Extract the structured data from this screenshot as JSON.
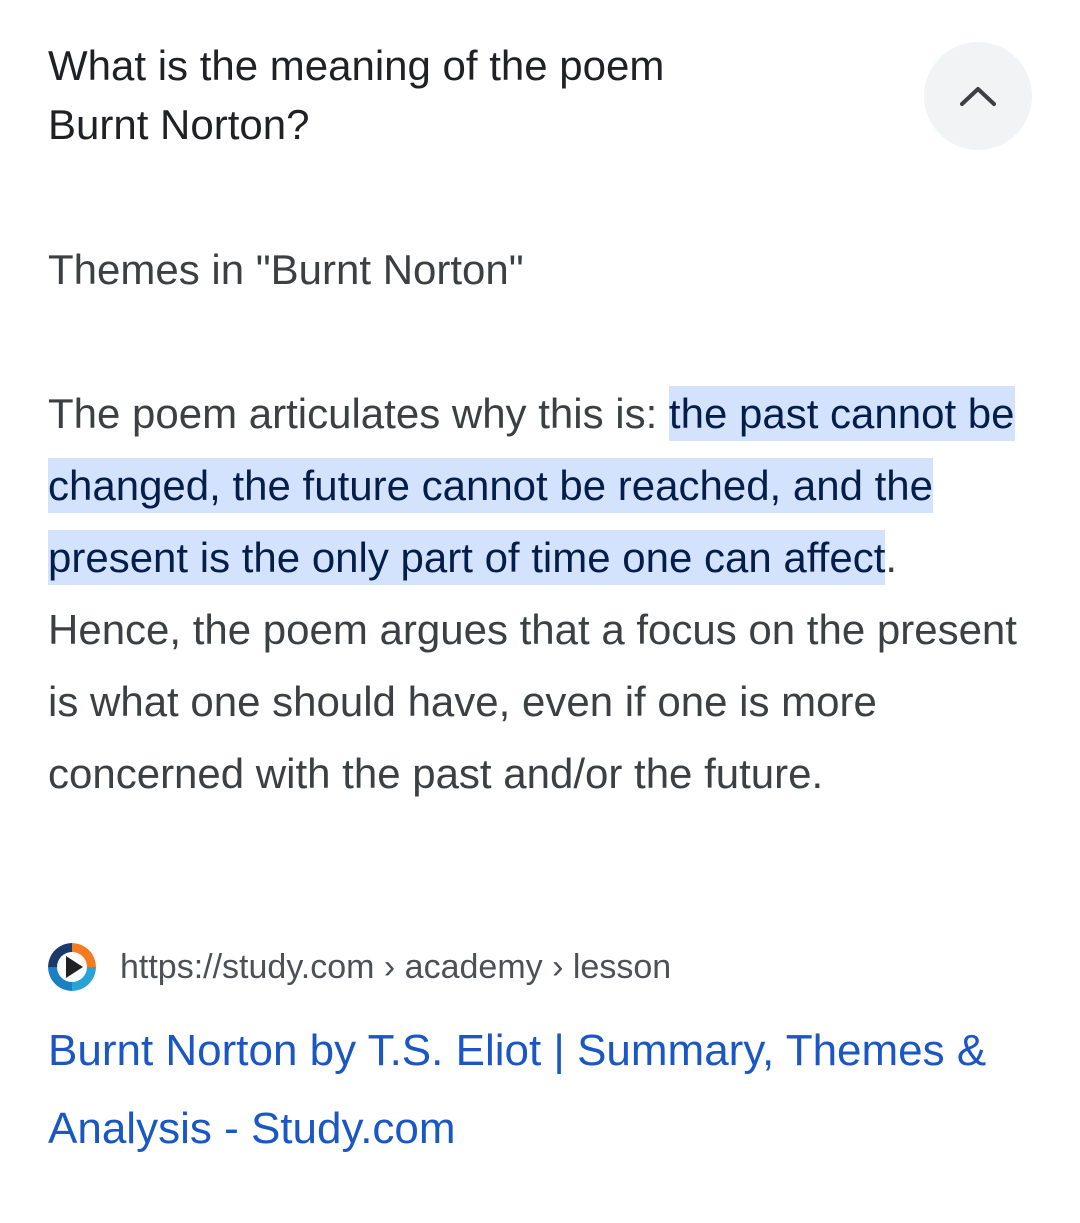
{
  "question": {
    "line1": "What is the meaning of the poem",
    "line2": "Burnt Norton?"
  },
  "collapse_button": {
    "icon": "chevron-up-icon"
  },
  "answer": {
    "heading": "Themes in \"Burnt Norton\"",
    "intro": "The poem articulates why this is: ",
    "highlight": "the past cannot be changed, the future cannot be reached, and the present is the only part of time one can affect",
    "rest": ". Hence, the poem argues that a focus on the present is what one should have, even if one is more concerned with the past and/or the future."
  },
  "source": {
    "favicon": "study-com-logo-icon",
    "url": "https://study.com › academy › lesson"
  },
  "result": {
    "title": "Burnt Norton by T.S. Eliot | Summary, Themes & Analysis - Study.com"
  },
  "colors": {
    "highlight_bg": "#d3e3fd",
    "link": "#1a56c4",
    "button_bg": "#f1f3f4"
  }
}
